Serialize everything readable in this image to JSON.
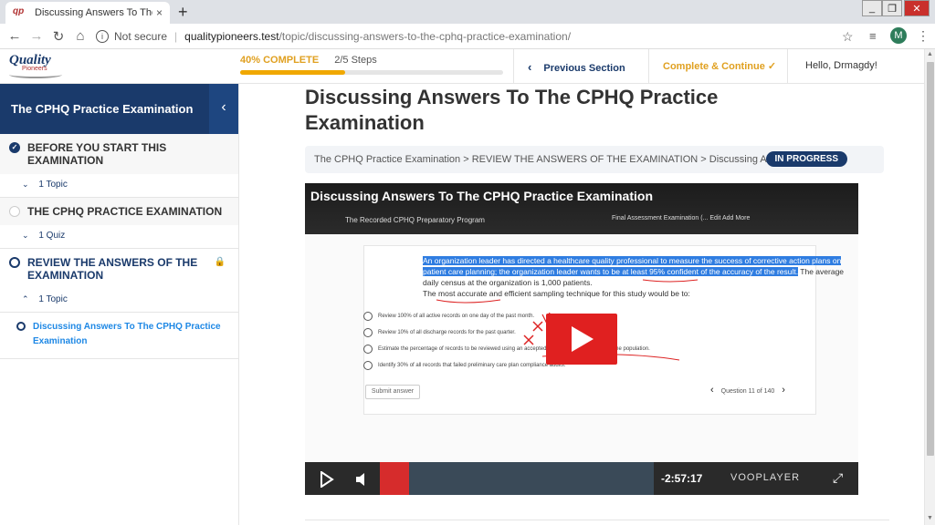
{
  "browser": {
    "tab_title": "Discussing Answers To The CPHQ",
    "favicon_text": "qp",
    "new_tab": "+",
    "close_tab": "×",
    "not_secure": "Not secure",
    "url_host": "qualitypioneers.test",
    "url_path": "/topic/discussing-answers-to-the-cphq-practice-examination/",
    "profile_initial": "M",
    "win_minimize": "_",
    "win_maximize": "❐",
    "win_close": "✕"
  },
  "header": {
    "logo_text": "Quality",
    "logo_sub": "Pioneers",
    "progress_percent_label": "40% COMPLETE",
    "progress_steps": "2/5 Steps",
    "progress_fraction": 0.4,
    "previous_section": "Previous Section",
    "complete_continue": "Complete & Continue",
    "hello": "Hello, Drmagdy!"
  },
  "sidebar": {
    "title": "The CPHQ Practice Examination",
    "sections": [
      {
        "title": "BEFORE YOU START THIS EXAMINATION",
        "count": "1 Topic",
        "status": "done"
      },
      {
        "title": "THE CPHQ PRACTICE EXAMINATION",
        "count": "1 Quiz",
        "status": "empty"
      },
      {
        "title": "REVIEW THE ANSWERS OF THE EXAMINATION",
        "count": "1 Topic",
        "status": "active"
      }
    ],
    "active_topic": "Discussing Answers To The CPHQ Practice Examination"
  },
  "main": {
    "title": "Discussing Answers To The CPHQ Practice Examination",
    "breadcrumb": "The CPHQ Practice Examination > REVIEW THE ANSWERS OF THE EXAMINATION > Discussing Answers...",
    "status_badge": "IN PROGRESS"
  },
  "video": {
    "title": "Discussing Answers To The CPHQ Practice Examination",
    "embedded_site": "The Recorded CPHQ Preparatory Program",
    "embedded_nav": "Final Assessment Examination (...   Edit   Add   More",
    "question_highlight": "An organization leader has directed a healthcare quality professional to measure the success of corrective action plans on patient care planning; the organization leader wants to be at least 95% confident of the accuracy of the result.",
    "question_rest": " The average daily census at the organization is 1,000 patients.",
    "question_prompt": "The most accurate and efficient sampling technique for this study would be to:",
    "options": [
      "Review 100% of all active records on one day of the past month.",
      "Review 10% of all discharge records for the past quarter.",
      "Estimate the percentage of records to be reviewed using an accepted statistical sample guide for the population.",
      "Identify 30% of all records that failed preliminary care plan compliance audits."
    ],
    "submit_label": "Submit answer",
    "question_counter": "Question 11 of 140",
    "time_remaining": "-2:57:17",
    "player_brand": "VOOPLAYER"
  }
}
